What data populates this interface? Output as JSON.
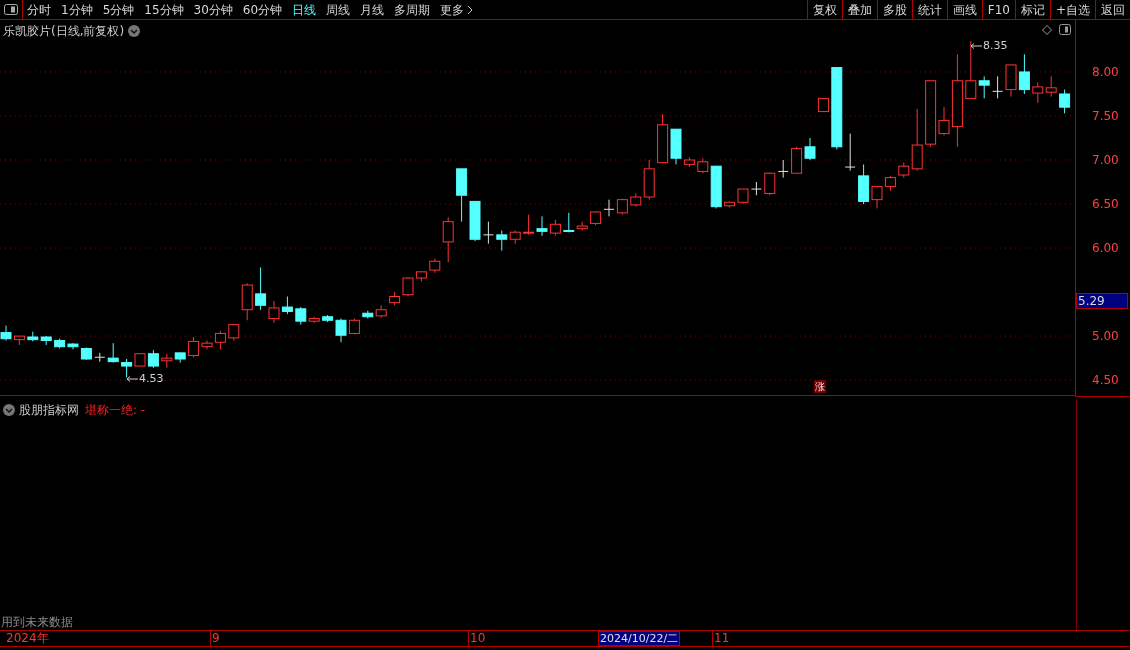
{
  "toolbar": {
    "periods": [
      {
        "label": "分时",
        "selected": false
      },
      {
        "label": "1分钟",
        "selected": false
      },
      {
        "label": "5分钟",
        "selected": false
      },
      {
        "label": "15分钟",
        "selected": false
      },
      {
        "label": "30分钟",
        "selected": false
      },
      {
        "label": "60分钟",
        "selected": false
      },
      {
        "label": "日线",
        "selected": true
      },
      {
        "label": "周线",
        "selected": false
      },
      {
        "label": "月线",
        "selected": false
      },
      {
        "label": "多周期",
        "selected": false
      },
      {
        "label": "更多",
        "selected": false
      }
    ],
    "buttons": [
      "复权",
      "叠加",
      "多股",
      "统计",
      "画线",
      "F10",
      "标记",
      "+自选",
      "返回"
    ]
  },
  "chart": {
    "title": "乐凯胶片(日线,前复权)",
    "current_price": "5.29",
    "high_marker": "8.35",
    "low_marker": "4.53",
    "badge": "涨",
    "chart_data": {
      "type": "candlestick",
      "ylim": [
        4.32,
        8.59
      ],
      "grid": true,
      "yticks": [
        {
          "value": 8.0,
          "label": "8.00"
        },
        {
          "value": 7.5,
          "label": "7.50"
        },
        {
          "value": 7.0,
          "label": "7.00"
        },
        {
          "value": 6.5,
          "label": "6.50"
        },
        {
          "value": 6.0,
          "label": "6.00"
        },
        {
          "value": 5.0,
          "label": "5.00"
        },
        {
          "value": 4.5,
          "label": "4.50"
        }
      ],
      "ohlc": [
        [
          5.04,
          5.12,
          4.95,
          4.97
        ],
        [
          4.96,
          5.0,
          4.9,
          5.0
        ],
        [
          4.99,
          5.05,
          4.94,
          4.96
        ],
        [
          4.99,
          5.0,
          4.9,
          4.95
        ],
        [
          4.95,
          4.97,
          4.86,
          4.88
        ],
        [
          4.91,
          4.92,
          4.85,
          4.88
        ],
        [
          4.86,
          4.87,
          4.73,
          4.74
        ],
        [
          4.76,
          4.81,
          4.71,
          4.76
        ],
        [
          4.75,
          4.92,
          4.7,
          4.71
        ],
        [
          4.7,
          4.74,
          4.53,
          4.66
        ],
        [
          4.66,
          4.8,
          4.66,
          4.8
        ],
        [
          4.8,
          4.84,
          4.64,
          4.66
        ],
        [
          4.72,
          4.8,
          4.64,
          4.75
        ],
        [
          4.81,
          4.81,
          4.7,
          4.74
        ],
        [
          4.78,
          4.99,
          4.76,
          4.94
        ],
        [
          4.88,
          4.95,
          4.85,
          4.92
        ],
        [
          4.93,
          5.06,
          4.85,
          5.03
        ],
        [
          4.98,
          5.14,
          4.95,
          5.13
        ],
        [
          5.3,
          5.6,
          5.18,
          5.58
        ],
        [
          5.48,
          5.78,
          5.3,
          5.35
        ],
        [
          5.2,
          5.4,
          5.15,
          5.32
        ],
        [
          5.33,
          5.45,
          5.25,
          5.28
        ],
        [
          5.31,
          5.33,
          5.13,
          5.17
        ],
        [
          5.17,
          5.22,
          5.15,
          5.2
        ],
        [
          5.22,
          5.24,
          5.16,
          5.18
        ],
        [
          5.18,
          5.2,
          4.93,
          5.01
        ],
        [
          5.03,
          5.2,
          5.02,
          5.18
        ],
        [
          5.26,
          5.29,
          5.2,
          5.22
        ],
        [
          5.23,
          5.35,
          5.21,
          5.3
        ],
        [
          5.38,
          5.5,
          5.35,
          5.45
        ],
        [
          5.47,
          5.67,
          5.45,
          5.66
        ],
        [
          5.66,
          5.74,
          5.62,
          5.73
        ],
        [
          5.75,
          5.88,
          5.72,
          5.85
        ],
        [
          6.07,
          6.35,
          5.84,
          6.3
        ],
        [
          6.9,
          6.9,
          6.3,
          6.6
        ],
        [
          6.53,
          6.53,
          6.08,
          6.1
        ],
        [
          6.15,
          6.3,
          6.05,
          6.15
        ],
        [
          6.15,
          6.2,
          5.97,
          6.1
        ],
        [
          6.1,
          6.2,
          6.05,
          6.18
        ],
        [
          6.17,
          6.38,
          6.15,
          6.18
        ],
        [
          6.22,
          6.36,
          6.14,
          6.19
        ],
        [
          6.17,
          6.32,
          6.14,
          6.27
        ],
        [
          6.2,
          6.4,
          6.18,
          6.19
        ],
        [
          6.22,
          6.3,
          6.2,
          6.25
        ],
        [
          6.28,
          6.42,
          6.26,
          6.41
        ],
        [
          6.44,
          6.55,
          6.36,
          6.44
        ],
        [
          6.4,
          6.56,
          6.38,
          6.55
        ],
        [
          6.49,
          6.62,
          6.47,
          6.58
        ],
        [
          6.58,
          7.0,
          6.55,
          6.9
        ],
        [
          6.97,
          7.52,
          6.97,
          7.4
        ],
        [
          7.35,
          7.35,
          6.95,
          7.02
        ],
        [
          6.95,
          7.03,
          6.92,
          7.0
        ],
        [
          6.87,
          7.02,
          6.85,
          6.98
        ],
        [
          6.93,
          6.93,
          6.45,
          6.47
        ],
        [
          6.48,
          6.53,
          6.46,
          6.52
        ],
        [
          6.52,
          6.67,
          6.5,
          6.67
        ],
        [
          6.67,
          6.75,
          6.6,
          6.67
        ],
        [
          6.62,
          6.86,
          6.6,
          6.85
        ],
        [
          6.87,
          7.0,
          6.8,
          6.87
        ],
        [
          6.85,
          7.15,
          6.85,
          7.13
        ],
        [
          7.15,
          7.25,
          7.0,
          7.02
        ],
        [
          7.55,
          7.7,
          7.55,
          7.7
        ],
        [
          8.05,
          8.05,
          7.12,
          7.15
        ],
        [
          6.92,
          7.3,
          6.88,
          6.92
        ],
        [
          6.82,
          6.95,
          6.5,
          6.53
        ],
        [
          6.55,
          6.7,
          6.45,
          6.7
        ],
        [
          6.7,
          6.82,
          6.65,
          6.8
        ],
        [
          6.83,
          6.97,
          6.8,
          6.93
        ],
        [
          6.9,
          7.58,
          6.88,
          7.17
        ],
        [
          7.18,
          7.9,
          7.15,
          7.9
        ],
        [
          7.3,
          7.6,
          7.28,
          7.45
        ],
        [
          7.38,
          8.2,
          7.15,
          7.9
        ],
        [
          7.7,
          8.35,
          7.7,
          7.9
        ],
        [
          7.9,
          7.95,
          7.7,
          7.85
        ],
        [
          7.78,
          7.95,
          7.7,
          7.78
        ],
        [
          7.8,
          8.08,
          7.72,
          8.08
        ],
        [
          8.0,
          8.2,
          7.75,
          7.8
        ],
        [
          7.76,
          7.88,
          7.65,
          7.83
        ],
        [
          7.77,
          7.95,
          7.72,
          7.82
        ],
        [
          7.75,
          7.8,
          7.53,
          7.6
        ]
      ]
    }
  },
  "indicator": {
    "name": "股朋指标网",
    "value": "堪称一绝: -"
  },
  "notice": "用到未来数据",
  "time_axis": [
    {
      "text": "2024年",
      "kind": "year"
    },
    {
      "text": "9",
      "kind": "month"
    },
    {
      "text": "10",
      "kind": "month"
    },
    {
      "text": "2024/10/22/二",
      "kind": "cursor"
    },
    {
      "text": "11",
      "kind": "month"
    }
  ]
}
